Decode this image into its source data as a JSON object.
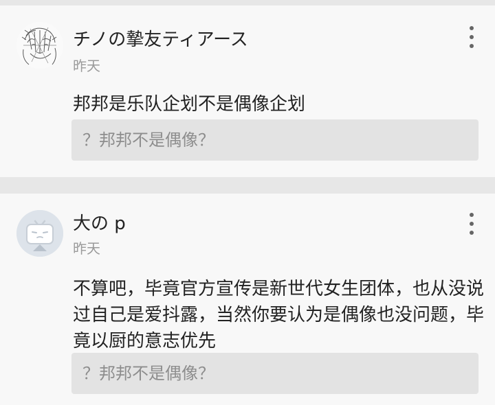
{
  "comments": [
    {
      "user_name": "チノの摯友ティアース",
      "time": "昨天",
      "text": "邦邦是乐队企划不是偶像企划",
      "tag": "？邦邦不是偶像？",
      "avatar_icon": "sketch-avatar-icon"
    },
    {
      "user_name": "大の p",
      "time": "昨天",
      "text": "不算吧，毕竟官方宣传是新世代女生团体，也从没说过自己是爱抖露，当然你要认为是偶像也没问题，毕竟以厨的意志优先",
      "tag": "？邦邦不是偶像？",
      "avatar_icon": "bilibili-tv-avatar-icon"
    }
  ],
  "colors": {
    "background": "#e7e7e7",
    "card": "#f8f8f8",
    "tag_box": "#e3e3e3",
    "secondary_text": "#9a9a9a"
  }
}
